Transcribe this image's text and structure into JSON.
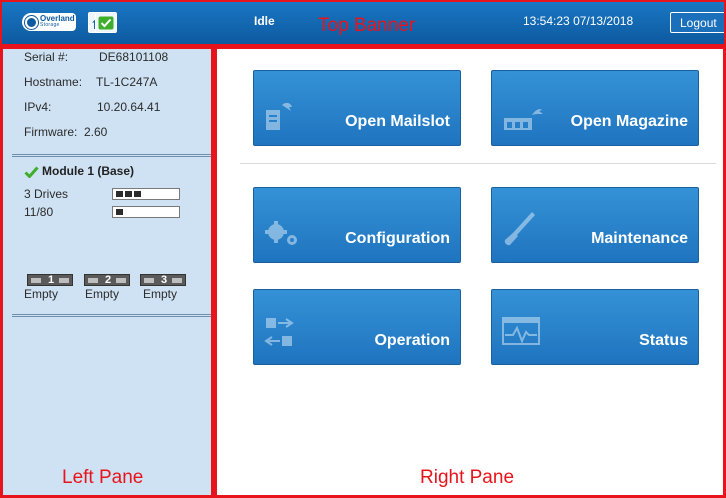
{
  "banner": {
    "logo_text": "Overland",
    "logo_subtext": "Storage",
    "status": "Idle",
    "caption": "Top Banner",
    "time": "13:54:23",
    "date": "07/13/2018",
    "logout_label": "Logout"
  },
  "left_pane": {
    "caption": "Left Pane",
    "info": [
      {
        "key": "Serial #:",
        "value": "DE68101108"
      },
      {
        "key": "Hostname:",
        "value": "TL-1C247A"
      },
      {
        "key": "IPv4:",
        "value": "10.20.64.41"
      },
      {
        "key": "Firmware:",
        "value": "2.60"
      }
    ],
    "module": {
      "title": "Module 1 (Base)",
      "drives_label": "3 Drives",
      "drives_level": 3,
      "slots_label": "11/80",
      "slots_level": 1,
      "magazines": [
        {
          "number": "1",
          "status": "Empty"
        },
        {
          "number": "2",
          "status": "Empty"
        },
        {
          "number": "3",
          "status": "Empty"
        }
      ]
    }
  },
  "right_pane": {
    "caption": "Right Pane",
    "tiles": [
      {
        "label": "Open Mailslot",
        "icon": "mailslot-icon"
      },
      {
        "label": "Open Magazine",
        "icon": "magazine-icon"
      },
      {
        "label": "Configuration",
        "icon": "gears-icon"
      },
      {
        "label": "Maintenance",
        "icon": "wrench-icon"
      },
      {
        "label": "Operation",
        "icon": "operation-icon"
      },
      {
        "label": "Status",
        "icon": "status-icon"
      }
    ]
  },
  "colors": {
    "banner": "#0d5aa0",
    "tile": "#2a82cc",
    "left_pane_bg": "#cfe2f3",
    "outline": "#e8141b",
    "check": "#3fae2a"
  }
}
